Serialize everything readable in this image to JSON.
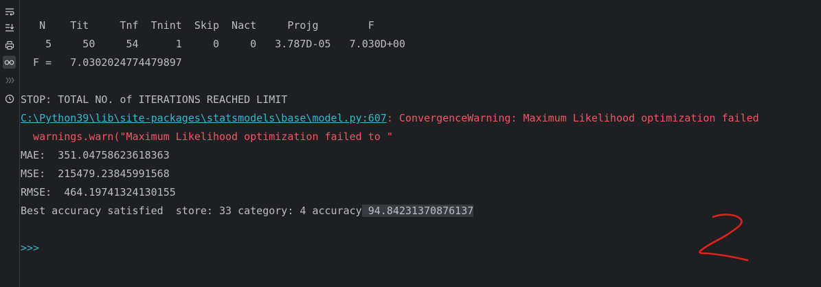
{
  "gutter": {
    "icons": [
      "soft-wrap-icon",
      "scroll-to-end-icon",
      "print-icon",
      "glasses-icon",
      "more-icon",
      "history-icon"
    ]
  },
  "console": {
    "table_header": "   N    Tit     Tnf  Tnint  Skip  Nact     Projg        F",
    "table_row": "    5     50     54      1     0     0   3.787D-05   7.030D+00",
    "f_line": "  F =   7.0302024774479897",
    "stop_line": "STOP: TOTAL NO. of ITERATIONS REACHED LIMIT",
    "warning_path": "C:\\Python39\\lib\\site-packages\\statsmodels\\base\\model.py:607",
    "warning_msg": ": ConvergenceWarning: Maximum Likelihood optimization failed",
    "warning_call": "  warnings.warn(\"Maximum Likelihood optimization failed to \"",
    "mae_line": "MAE:  351.04758623618363",
    "mse_line": "MSE:  215479.23845991568",
    "rmse_line": "RMSE:  464.19741324130155",
    "best_prefix": "Best accuracy satisfied  store: 33 category: 4 accuracy",
    "best_value": " 94.84231370876137",
    "prompt": ">>>"
  },
  "colors": {
    "background": "#1e1f22",
    "text": "#bcbec4",
    "error": "#f75464",
    "link": "#2fbad0",
    "highlight": "#373a3f",
    "scribble": "#e0221a"
  }
}
